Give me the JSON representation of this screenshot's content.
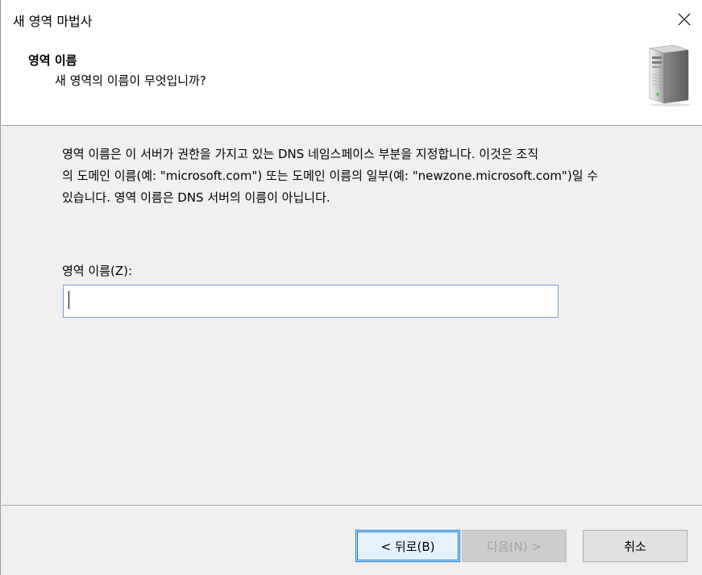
{
  "window": {
    "title": "새 영역 마법사",
    "close_icon": "close-icon"
  },
  "header": {
    "title": "영역 이름",
    "subtitle": "새 영역의 이름이 무엇입니까?",
    "icon": "server-tower-icon"
  },
  "body": {
    "description_line1": "영역 이름은 이 서버가 권한을 가지고 있는 DNS 네임스페이스 부분을 지정합니다. 이것은 조직",
    "description_line2": "의 도메인 이름(예: \"microsoft.com\") 또는 도메인 이름의 일부(예: \"newzone.microsoft.com\")일 수",
    "description_line3": "있습니다. 영역 이름은 DNS 서버의 이름이 아닙니다.",
    "zone_name_label": "영역 이름(Z):",
    "zone_name_value": ""
  },
  "buttons": {
    "back": "< 뒤로(B)",
    "next": "다음(N) >",
    "cancel": "취소",
    "next_enabled": false
  },
  "colors": {
    "accent": "#0078d7",
    "input_border": "#7a9ccf",
    "disabled_text": "#a0a0a0"
  }
}
